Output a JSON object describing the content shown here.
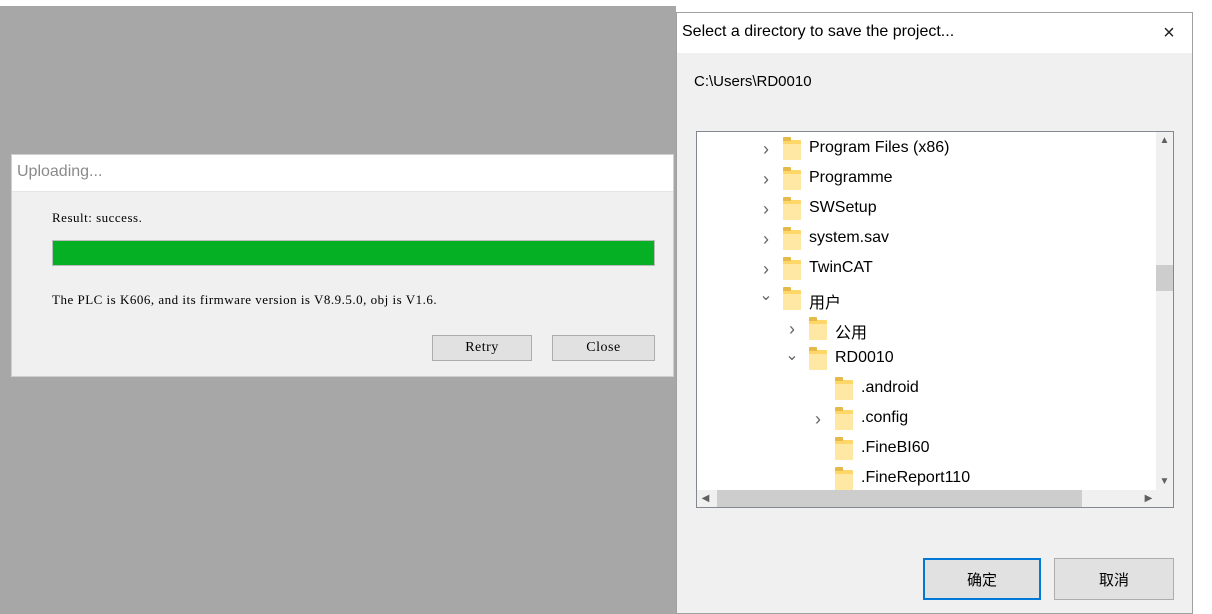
{
  "upload_dialog": {
    "title": "Uploading...",
    "result_text": "Result: success.",
    "progress": 1.0,
    "progress_color": "#06b025",
    "plc_info": "The PLC is  K606, and its firmware version is V8.9.5.0, obj is V1.6.",
    "retry_label": "Retry",
    "close_label": "Close"
  },
  "directory_dialog": {
    "title": "Select a directory to save the project...",
    "close_icon": "×",
    "path": "C:\\Users\\RD0010",
    "tree_items": [
      {
        "label": "Program Files (x86)",
        "expander": "collapsed"
      },
      {
        "label": "Programme",
        "expander": "collapsed"
      },
      {
        "label": "SWSetup",
        "expander": "collapsed"
      },
      {
        "label": "system.sav",
        "expander": "collapsed"
      },
      {
        "label": "TwinCAT",
        "expander": "collapsed"
      },
      {
        "label": "用户",
        "expander": "expanded"
      },
      {
        "label": "公用",
        "expander": "collapsed"
      },
      {
        "label": "RD0010",
        "expander": "expanded"
      },
      {
        "label": ".android",
        "expander": "none"
      },
      {
        "label": ".config",
        "expander": "collapsed"
      },
      {
        "label": ".FineBI60",
        "expander": "none"
      },
      {
        "label": ".FineReport110",
        "expander": "none"
      }
    ],
    "ok_label": "确定",
    "cancel_label": "取消",
    "accent_color": "#0078d7"
  }
}
